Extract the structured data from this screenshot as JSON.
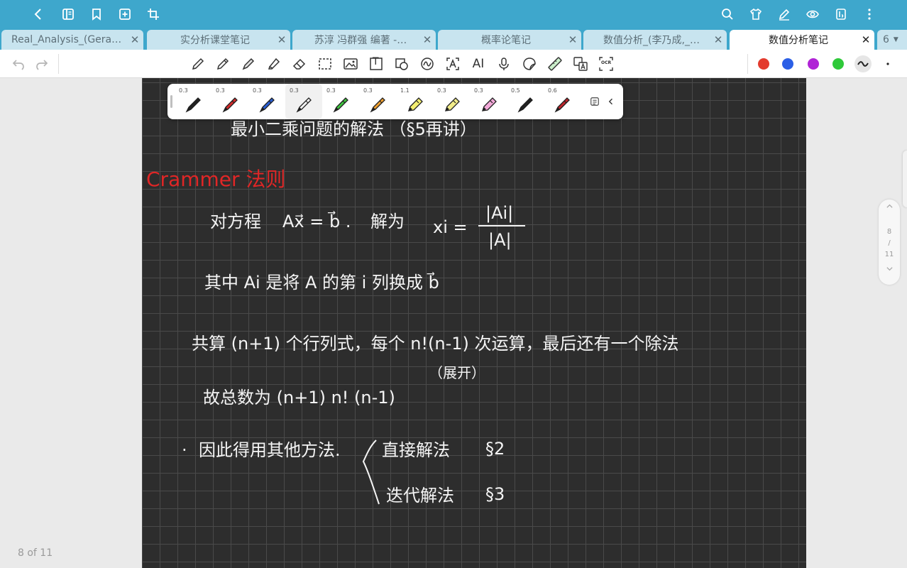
{
  "topbar": {
    "left_icons": [
      "back-icon",
      "sidebar-icon",
      "bookmark-icon",
      "add-page-icon",
      "crop-icon"
    ],
    "right_icons": [
      "search-icon",
      "shirt-icon",
      "pen-settings-icon",
      "eye-icon",
      "page-view-icon",
      "more-icon"
    ]
  },
  "tabs": [
    {
      "label": "Real_Analysis_(Gera…",
      "close": "✕"
    },
    {
      "label": "实分析课堂笔记",
      "close": "✕"
    },
    {
      "label": "苏淳 冯群强 编著 -…",
      "close": "✕"
    },
    {
      "label": "概率论笔记",
      "close": "✕"
    },
    {
      "label": "数值分析_(李乃成,_…",
      "close": "✕"
    },
    {
      "label": "数值分析笔记",
      "close": "✕",
      "active": true
    }
  ],
  "tab_overflow": {
    "count": "6"
  },
  "toolbar": {
    "text_tool": "T",
    "ai_tool": "AI",
    "ocr_tool": "OCR",
    "colors": [
      "#e33b2e",
      "#2b5fe6",
      "#b023d6",
      "#2fc93a"
    ]
  },
  "palette": {
    "pens": [
      {
        "width": "0.3",
        "color": "#222222",
        "kind": "pen"
      },
      {
        "width": "0.3",
        "color": "#d42a2a",
        "kind": "pen"
      },
      {
        "width": "0.3",
        "color": "#2a5fd4",
        "kind": "pen"
      },
      {
        "width": "0.3",
        "color": "#f5f5f5",
        "kind": "pen"
      },
      {
        "width": "0.3",
        "color": "#3ec43e",
        "kind": "pen"
      },
      {
        "width": "0.3",
        "color": "#f0a030",
        "kind": "pen"
      },
      {
        "width": "1.1",
        "color": "#f4ee70",
        "kind": "highlighter"
      },
      {
        "width": "0.3",
        "color": "#f2ec8a",
        "kind": "highlighter"
      },
      {
        "width": "0.3",
        "color": "#f3a9d9",
        "kind": "highlighter"
      },
      {
        "width": "0.5",
        "color": "#222222",
        "kind": "pen"
      },
      {
        "width": "0.6",
        "color": "#c0262c",
        "kind": "pen"
      }
    ]
  },
  "notes": {
    "line_top": "最小二乘问题的解法 （§5再讲）",
    "heading": "Crammer 法则",
    "eq_intro": "对方程",
    "eq_system": "Ax⃗ = b⃗ .",
    "eq_solution_label": "解为",
    "eq_var": "xi =",
    "eq_numerator": "|Ai|",
    "eq_denominator": "|A|",
    "line2": "其中 Ai 是将 A 的第 i 列换成 b⃗",
    "line3": "共算 (n+1) 个行列式，每个 n!(n-1) 次运算，最后还有一个除法",
    "line3_note": "（展开）",
    "line4": "故总数为 (n+1) n! (n-1)",
    "line5_bullet": "·",
    "line5": "因此得用其他方法.",
    "method1": "直接解法",
    "method1_ref": "§2",
    "method2": "迭代解法",
    "method2_ref": "§3"
  },
  "pagenav": {
    "current": "8",
    "slash": "/",
    "total": "11",
    "up": "^",
    "down": "v"
  },
  "page_indicator": "8 of 11"
}
